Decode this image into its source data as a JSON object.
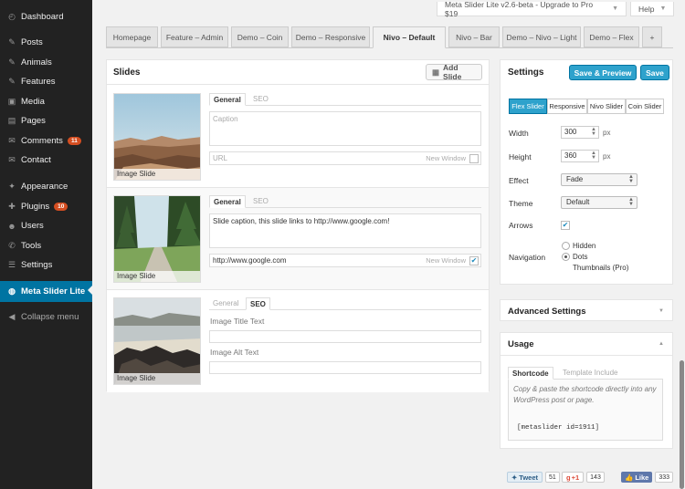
{
  "sidebar": {
    "items": [
      {
        "label": "Dashboard",
        "icon": "dashboard-icon",
        "glyph": "◴"
      },
      {
        "label": "Posts",
        "icon": "pushpin-icon",
        "glyph": "✎"
      },
      {
        "label": "Animals",
        "icon": "pushpin-icon",
        "glyph": "✎"
      },
      {
        "label": "Features",
        "icon": "pushpin-icon",
        "glyph": "✎"
      },
      {
        "label": "Media",
        "icon": "media-icon",
        "glyph": "▣"
      },
      {
        "label": "Pages",
        "icon": "pages-icon",
        "glyph": "▤"
      },
      {
        "label": "Comments",
        "icon": "comments-icon",
        "glyph": "✉",
        "badge": "11"
      },
      {
        "label": "Contact",
        "icon": "contact-icon",
        "glyph": "✉"
      },
      {
        "label": "Appearance",
        "icon": "appearance-icon",
        "glyph": "✦"
      },
      {
        "label": "Plugins",
        "icon": "plugins-icon",
        "glyph": "✚",
        "badge": "10"
      },
      {
        "label": "Users",
        "icon": "users-icon",
        "glyph": "☻"
      },
      {
        "label": "Tools",
        "icon": "tools-icon",
        "glyph": "✆"
      },
      {
        "label": "Settings",
        "icon": "settings-icon",
        "glyph": "☰"
      },
      {
        "label": "Meta Slider Lite",
        "icon": "meta-slider-icon",
        "glyph": "◍"
      },
      {
        "label": "Collapse menu",
        "icon": "collapse-icon",
        "glyph": "◀"
      }
    ]
  },
  "topbar": {
    "upgrade_label": "Meta Slider Lite v2.6-beta - Upgrade to Pro $19",
    "help_label": "Help"
  },
  "tabs": [
    "Homepage",
    "Feature – Admin",
    "Demo – Coin",
    "Demo – Responsive",
    "Nivo – Default",
    "Nivo – Bar",
    "Demo – Nivo – Light",
    "Demo – Flex",
    "+"
  ],
  "slides_panel": {
    "title": "Slides",
    "add_button": "Add Slide",
    "slides": [
      {
        "thumb_label": "Image Slide",
        "tab_general": "General",
        "tab_seo": "SEO",
        "caption_placeholder": "Caption",
        "caption_value": "",
        "url_placeholder": "URL",
        "url_value": "",
        "new_window_label": "New Window",
        "new_window_checked": false
      },
      {
        "thumb_label": "Image Slide",
        "tab_general": "General",
        "tab_seo": "SEO",
        "caption_value": "Slide caption, this slide links to http://www.google.com!",
        "url_value": "http://www.google.com",
        "new_window_label": "New Window",
        "new_window_checked": true
      },
      {
        "thumb_label": "Image Slide",
        "tab_general": "General",
        "tab_seo": "SEO",
        "image_title_label": "Image Title Text",
        "image_alt_label": "Image Alt Text"
      }
    ]
  },
  "settings": {
    "title": "Settings",
    "save_preview_label": "Save & Preview",
    "save_label": "Save",
    "slider_types": [
      "Flex Slider",
      "Responsive",
      "Nivo Slider",
      "Coin Slider"
    ],
    "selected_type": "Flex Slider",
    "width_label": "Width",
    "width_value": "300",
    "height_label": "Height",
    "height_value": "360",
    "unit": "px",
    "effect_label": "Effect",
    "effect_value": "Fade",
    "theme_label": "Theme",
    "theme_value": "Default",
    "arrows_label": "Arrows",
    "arrows_checked": true,
    "navigation_label": "Navigation",
    "navigation_options": [
      "Hidden",
      "Dots",
      "Thumbnails (Pro)"
    ],
    "navigation_selected": "Dots"
  },
  "advanced": {
    "title": "Advanced Settings"
  },
  "usage": {
    "title": "Usage",
    "tab_shortcode": "Shortcode",
    "tab_template": "Template Include",
    "description": "Copy & paste the shortcode directly into any WordPress post or page.",
    "shortcode": "[metaslider id=1911]"
  },
  "social": {
    "tweet_label": "Tweet",
    "tweet_count": "51",
    "gplus_label": "+1",
    "gplus_count": "143",
    "like_label": "Like",
    "like_count": "333"
  },
  "colors": {
    "sidebar_bg": "#222222",
    "active_menu": "#0074a2",
    "primary_button": "#2ea2cc",
    "badge": "#d54e21"
  }
}
